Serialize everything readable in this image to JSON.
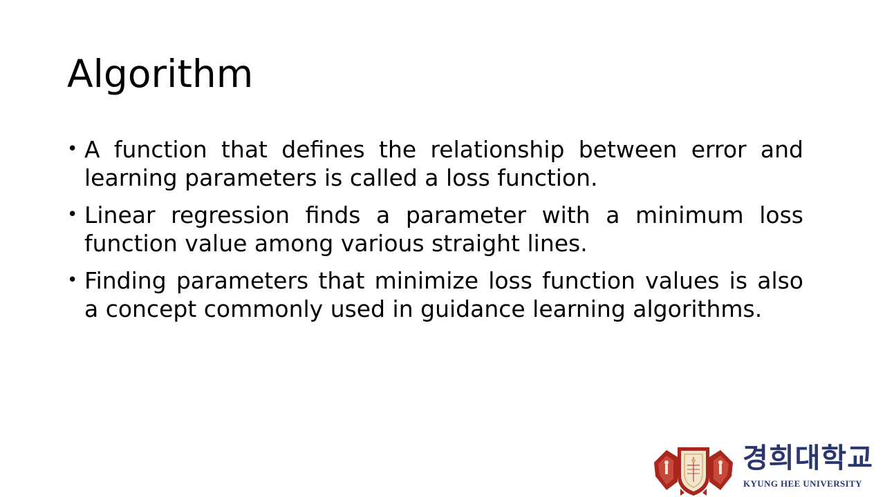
{
  "slide": {
    "title": "Algorithm",
    "bullets": [
      "A function that defines the relationship between error and learning parameters is called a loss function.",
      "Linear regression finds a parameter with a minimum loss function value among various straight lines.",
      "Finding parameters that minimize loss function values is also a concept commonly used in guidance learning algorithms."
    ],
    "bullet_marker": "•"
  },
  "logo": {
    "korean_name": "경희대학교",
    "english_name": "KYUNG HEE UNIVERSITY",
    "colors": {
      "seal_red": "#a8261e",
      "seal_gold": "#d9b26a",
      "text_navy": "#2a3670"
    }
  }
}
